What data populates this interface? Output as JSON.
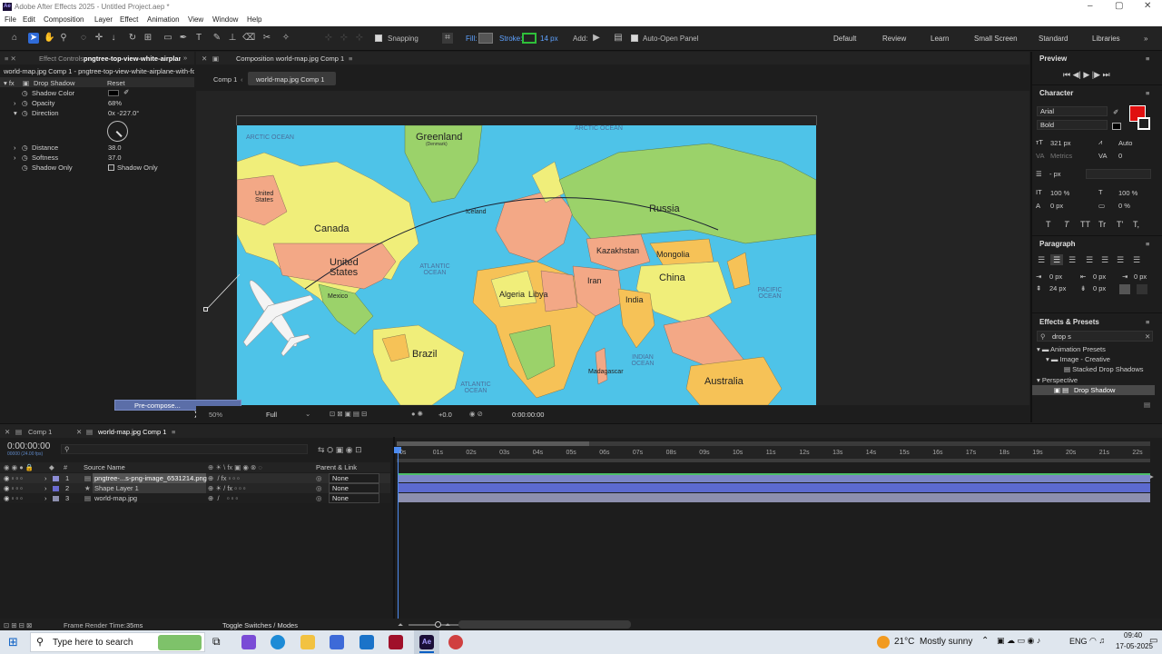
{
  "window": {
    "title": "Adobe After Effects 2025 - Untitled Project.aep *"
  },
  "menu": [
    "File",
    "Edit",
    "Composition",
    "Layer",
    "Effect",
    "Animation",
    "View",
    "Window",
    "Help"
  ],
  "toolbar": {
    "snapping": "Snapping",
    "fill": "Fill:",
    "stroke": "Stroke:",
    "stroke_px": "14 px",
    "add": "Add:",
    "auto_open": "Auto-Open Panel",
    "workspaces": [
      "Default",
      "Review",
      "Learn",
      "Small Screen",
      "Standard",
      "Libraries"
    ]
  },
  "effect_controls": {
    "tab": "Effect Controls",
    "tab_layer": "pngtree-top-view-white-airplane",
    "layer_path": "world-map.jpg Comp 1 - pngtree-top-view-white-airplane-with-fc",
    "fx_name": "Drop Shadow",
    "reset": "Reset",
    "shadow_color": "Shadow Color",
    "opacity_label": "Opacity",
    "opacity_value": "68%",
    "direction_label": "Direction",
    "direction_value": "0x -227.0°",
    "distance_label": "Distance",
    "distance_value": "38.0",
    "softness_label": "Softness",
    "softness_value": "37.0",
    "shadow_only_label": "Shadow Only",
    "shadow_only_check": "Shadow Only"
  },
  "composition": {
    "tab": "Composition world-map.jpg Comp 1",
    "crumb1": "Comp 1",
    "crumb2": "world-map.jpg Comp 1",
    "zoom": "50%",
    "resolution": "Full",
    "exposure": "+0.0",
    "timecode": "0:00:00:00",
    "context_menu_item": "Pre-compose..."
  },
  "map": {
    "oceans": [
      "ARCTIC OCEAN",
      "ARCTIC OCEAN",
      "ATLANTIC OCEAN",
      "PACIFIC OCEAN",
      "INDIAN OCEAN",
      "ATLANTIC OCEAN"
    ],
    "countries": {
      "greenland": "Greenland",
      "greenland_sub": "(Denmark)",
      "russia": "Russia",
      "canada": "Canada",
      "united_states_small": "United States",
      "united_states": "United States",
      "kazakhstan": "Kazakhstan",
      "mongolia": "Mongolia",
      "china": "China",
      "iran": "Iran",
      "india": "India",
      "algeria": "Algeria",
      "libya": "Libya",
      "brazil": "Brazil",
      "australia": "Australia",
      "mexico": "Mexico",
      "iceland": "Iceland",
      "madagascar": "Madagascar"
    }
  },
  "preview": {
    "title": "Preview"
  },
  "character": {
    "title": "Character",
    "font": "Arial",
    "style": "Bold",
    "size": "321 px",
    "leading": "Auto",
    "kerning": "Metrics",
    "tracking": "0",
    "line_unit": "- px",
    "vscale": "100 %",
    "hscale": "100 %",
    "baseline": "0 px",
    "tsume": "0 %",
    "styles": [
      "T",
      "T",
      "TT",
      "Tr",
      "T'",
      "T,"
    ]
  },
  "paragraph": {
    "title": "Paragraph",
    "indent1": "0 px",
    "indent2": "0 px",
    "indent3": "0 px",
    "space1": "24 px",
    "space2": "0 px"
  },
  "effects_presets": {
    "title": "Effects & Presets",
    "search": "drop s",
    "items": [
      "Animation Presets",
      "Image - Creative",
      "Stacked Drop Shadows",
      "Perspective",
      "Drop Shadow"
    ]
  },
  "timeline": {
    "tabs": [
      "Comp 1",
      "world-map.jpg Comp 1"
    ],
    "timecode": "0:00:00:00",
    "fps": "00000 (24.00 fps)",
    "col_source": "Source Name",
    "col_parent": "Parent & Link",
    "layers": [
      {
        "num": "1",
        "name": "pngtree-...s-png-image_6531214.png",
        "parent": "None"
      },
      {
        "num": "2",
        "name": "Shape Layer 1",
        "parent": "None"
      },
      {
        "num": "3",
        "name": "world-map.jpg",
        "parent": "None"
      }
    ],
    "ticks": [
      "0s",
      "01s",
      "02s",
      "03s",
      "04s",
      "05s",
      "06s",
      "07s",
      "08s",
      "09s",
      "10s",
      "11s",
      "12s",
      "13s",
      "14s",
      "15s",
      "16s",
      "17s",
      "18s",
      "19s",
      "20s",
      "21s",
      "22s"
    ],
    "render_label": "Frame Render Time:",
    "render_value": "35ms",
    "toggle": "Toggle Switches / Modes"
  },
  "taskbar": {
    "search": "Type here to search",
    "weather_temp": "21°C",
    "weather_desc": "Mostly sunny",
    "lang": "ENG",
    "time": "09:40",
    "date": "17-05-2025"
  },
  "colors": {
    "accent_blue": "#2f6bd8",
    "fill_red": "#e01010",
    "layer_bar_1": "#7a86c6",
    "layer_bar_2": "#5c6ad0",
    "layer_bar_3": "#8d8fae",
    "ocean": "#4ec3e8"
  }
}
